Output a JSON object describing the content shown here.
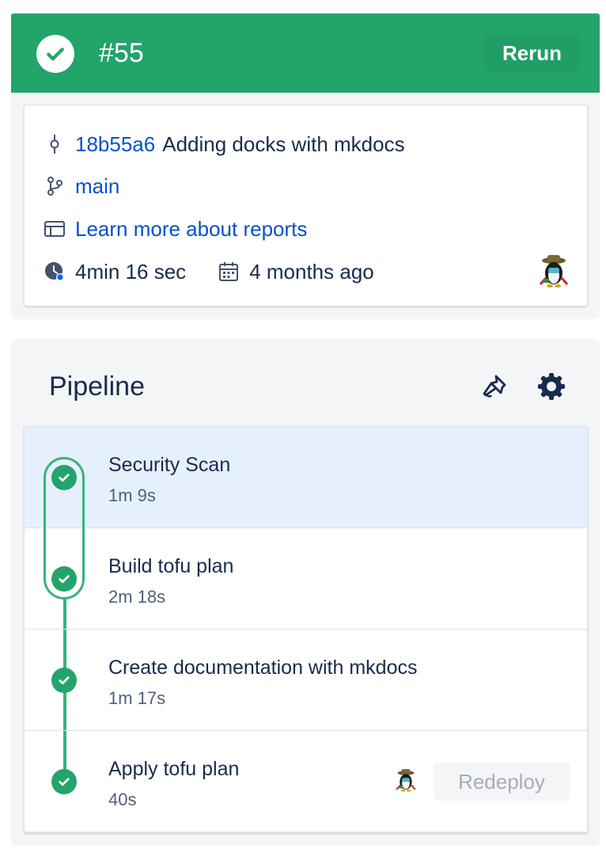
{
  "header": {
    "run_number": "#55",
    "rerun_label": "Rerun",
    "status_icon": "check-circle-icon",
    "status_color": "#23a46b"
  },
  "info": {
    "commit_hash": "18b55a6",
    "commit_message": "Adding docks with mkdocs",
    "branch": "main",
    "reports_link": "Learn more about reports",
    "duration": "4min 16 sec",
    "started": "4 months ago"
  },
  "pipeline": {
    "title": "Pipeline",
    "steps": [
      {
        "name": "Security Scan",
        "duration": "1m 9s",
        "status": "success"
      },
      {
        "name": "Build tofu plan",
        "duration": "2m 18s",
        "status": "success"
      },
      {
        "name": "Create documentation with mkdocs",
        "duration": "1m 17s",
        "status": "success"
      },
      {
        "name": "Apply tofu plan",
        "duration": "40s",
        "status": "success"
      }
    ],
    "redeploy_label": "Redeploy"
  },
  "colors": {
    "success": "#23a46b",
    "link": "#0052cc",
    "selected_row": "#e6f0fc"
  }
}
